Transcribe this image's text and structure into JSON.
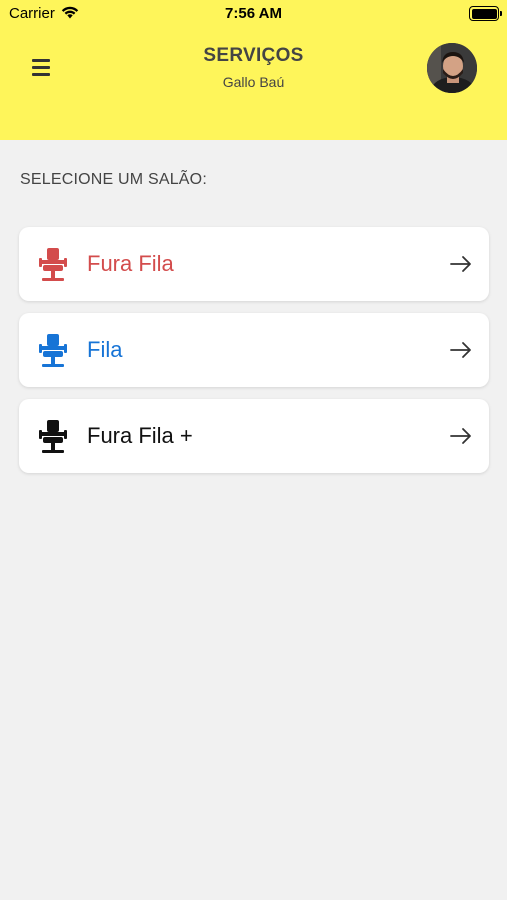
{
  "status_bar": {
    "carrier": "Carrier",
    "time": "7:56 AM"
  },
  "header": {
    "title": "SERVIÇOS",
    "subtitle": "Gallo Baú",
    "background": "#fef55a"
  },
  "section_label": "SELECIONE UM SALÃO:",
  "options": [
    {
      "label": "Fura Fila",
      "color": "#d34c4c",
      "icon": "barber-chair-icon"
    },
    {
      "label": "Fila",
      "color": "#1774d6",
      "icon": "barber-chair-icon"
    },
    {
      "label": "Fura Fila +",
      "color": "#111111",
      "icon": "barber-chair-icon"
    }
  ]
}
